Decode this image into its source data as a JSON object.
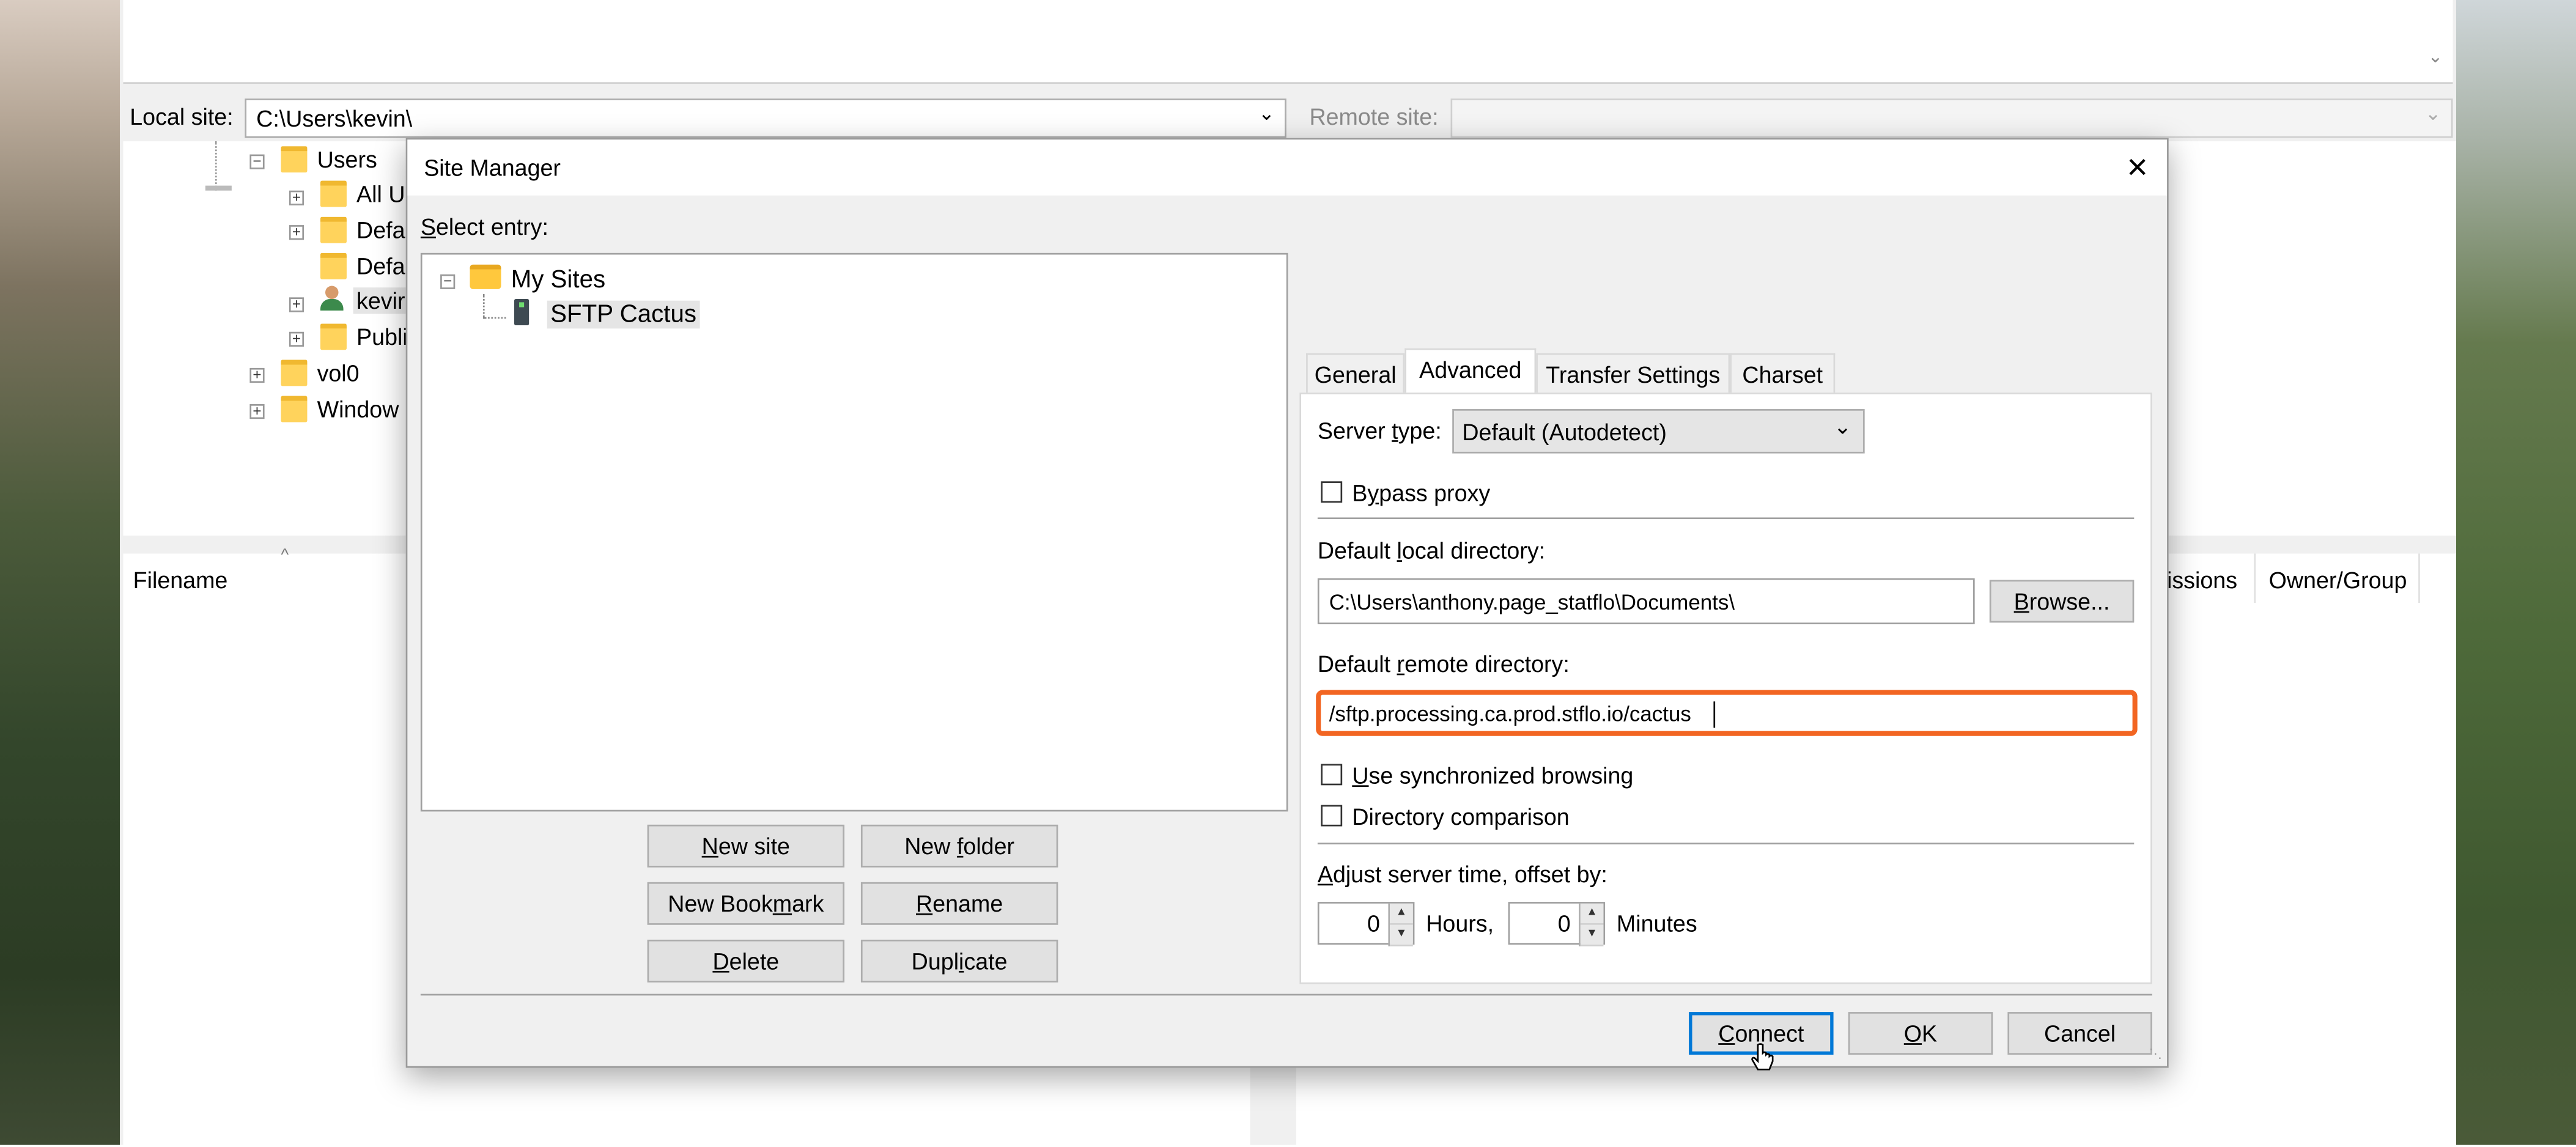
{
  "main_window": {
    "local_site_label": "Local site:",
    "local_site_path": "C:\\Users\\kevin\\",
    "remote_site_label": "Remote site:",
    "local_tree": [
      {
        "label": "Users"
      },
      {
        "label": "All U"
      },
      {
        "label": "Defa"
      },
      {
        "label": "Defa"
      },
      {
        "label": "kevir"
      },
      {
        "label": "Publi"
      },
      {
        "label": "vol0"
      },
      {
        "label": "Window"
      }
    ],
    "file_columns": {
      "filename": "Filename",
      "permissions": "issions",
      "owner_group": "Owner/Group"
    }
  },
  "dialog": {
    "title": "Site Manager",
    "select_entry_label": "Select entry:",
    "tree": {
      "root": "My Sites",
      "site": "SFTP Cactus"
    },
    "buttons": {
      "new_site": "New site",
      "new_folder": "New folder",
      "new_bookmark": "New Bookmark",
      "rename": "Rename",
      "delete": "Delete",
      "duplicate": "Duplicate",
      "connect": "Connect",
      "ok": "OK",
      "cancel": "Cancel"
    },
    "tabs": [
      "General",
      "Advanced",
      "Transfer Settings",
      "Charset"
    ],
    "active_tab": "Advanced",
    "advanced": {
      "server_type_label": "Server type:",
      "server_type_value": "Default (Autodetect)",
      "bypass_proxy_label": "Bypass proxy",
      "bypass_proxy_checked": false,
      "default_local_dir_label": "Default local directory:",
      "default_local_dir_value": "C:\\Users\\anthony.page_statflo\\Documents\\",
      "browse_label": "Browse...",
      "default_remote_dir_label": "Default remote directory:",
      "default_remote_dir_value": "/sftp.processing.ca.prod.stflo.io/cactus",
      "sync_browsing_label": "Use synchronized browsing",
      "sync_browsing_checked": false,
      "dir_comparison_label": "Directory comparison",
      "dir_comparison_checked": false,
      "adjust_time_label": "Adjust server time, offset by:",
      "hours_value": "0",
      "hours_label": "Hours,",
      "minutes_value": "0",
      "minutes_label": "Minutes"
    }
  },
  "colors": {
    "highlight_border": "#f26522",
    "default_button_border": "#0078d7",
    "folder": "#ffd35c"
  }
}
